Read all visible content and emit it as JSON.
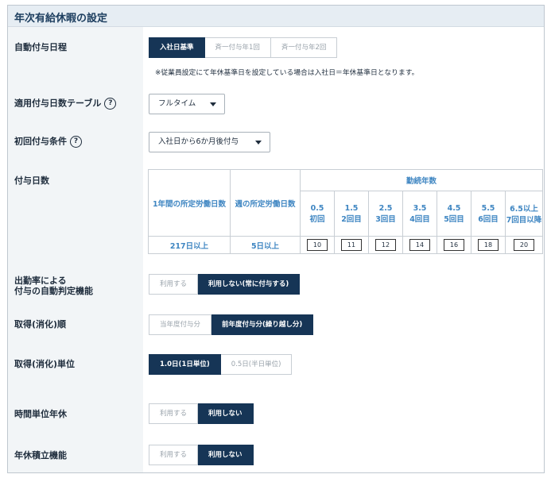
{
  "title": "年次有給休暇の設定",
  "rows": {
    "schedule": {
      "label": "自動付与日程",
      "options": [
        "入社日基準",
        "斉一付与年1回",
        "斉一付与年2回"
      ],
      "selected": "入社日基準",
      "note": "※従業員設定にて年休基準日を設定している場合は入社日＝年休基準日となります。"
    },
    "table_select": {
      "label": "適用付与日数テーブル",
      "help": "?",
      "value": "フルタイム"
    },
    "first_grant": {
      "label": "初回付与条件",
      "help": "?",
      "value": "入社日から6か月後付与"
    },
    "grant_days": {
      "label": "付与日数",
      "header_work_hours": "1年間の所定労働日数",
      "header_week_days": "週の所定労働日数",
      "header_years": "勤続年数",
      "year_columns": [
        {
          "years": "0.5",
          "label": "初回"
        },
        {
          "years": "1.5",
          "label": "2回目"
        },
        {
          "years": "2.5",
          "label": "3回目"
        },
        {
          "years": "3.5",
          "label": "4回目"
        },
        {
          "years": "4.5",
          "label": "5回目"
        },
        {
          "years": "5.5",
          "label": "6回目"
        },
        {
          "years": "6.5以上",
          "label": "7回目以降"
        }
      ],
      "row": {
        "annual": "217日以上",
        "weekly": "5日以上",
        "days": [
          "10",
          "11",
          "12",
          "14",
          "16",
          "18",
          "20"
        ]
      }
    },
    "auto_judge": {
      "label_line1": "出勤率による",
      "label_line2": "付与の自動判定機能",
      "options": [
        "利用する",
        "利用しない(常に付与する)"
      ],
      "selected": "利用しない(常に付与する)"
    },
    "consume_order": {
      "label": "取得(消化)順",
      "options": [
        "当年度付与分",
        "前年度付与分(繰り越し分)"
      ],
      "selected": "前年度付与分(繰り越し分)"
    },
    "consume_unit": {
      "label": "取得(消化)単位",
      "options": [
        "1.0日(1日単位)",
        "0.5日(半日単位)"
      ],
      "selected": "1.0日(1日単位)"
    },
    "hourly_leave": {
      "label": "時間単位年休",
      "options": [
        "利用する",
        "利用しない"
      ],
      "selected": "利用しない"
    },
    "accumulation": {
      "label": "年休積立機能",
      "options": [
        "利用する",
        "利用しない"
      ],
      "selected": "利用しない"
    }
  }
}
